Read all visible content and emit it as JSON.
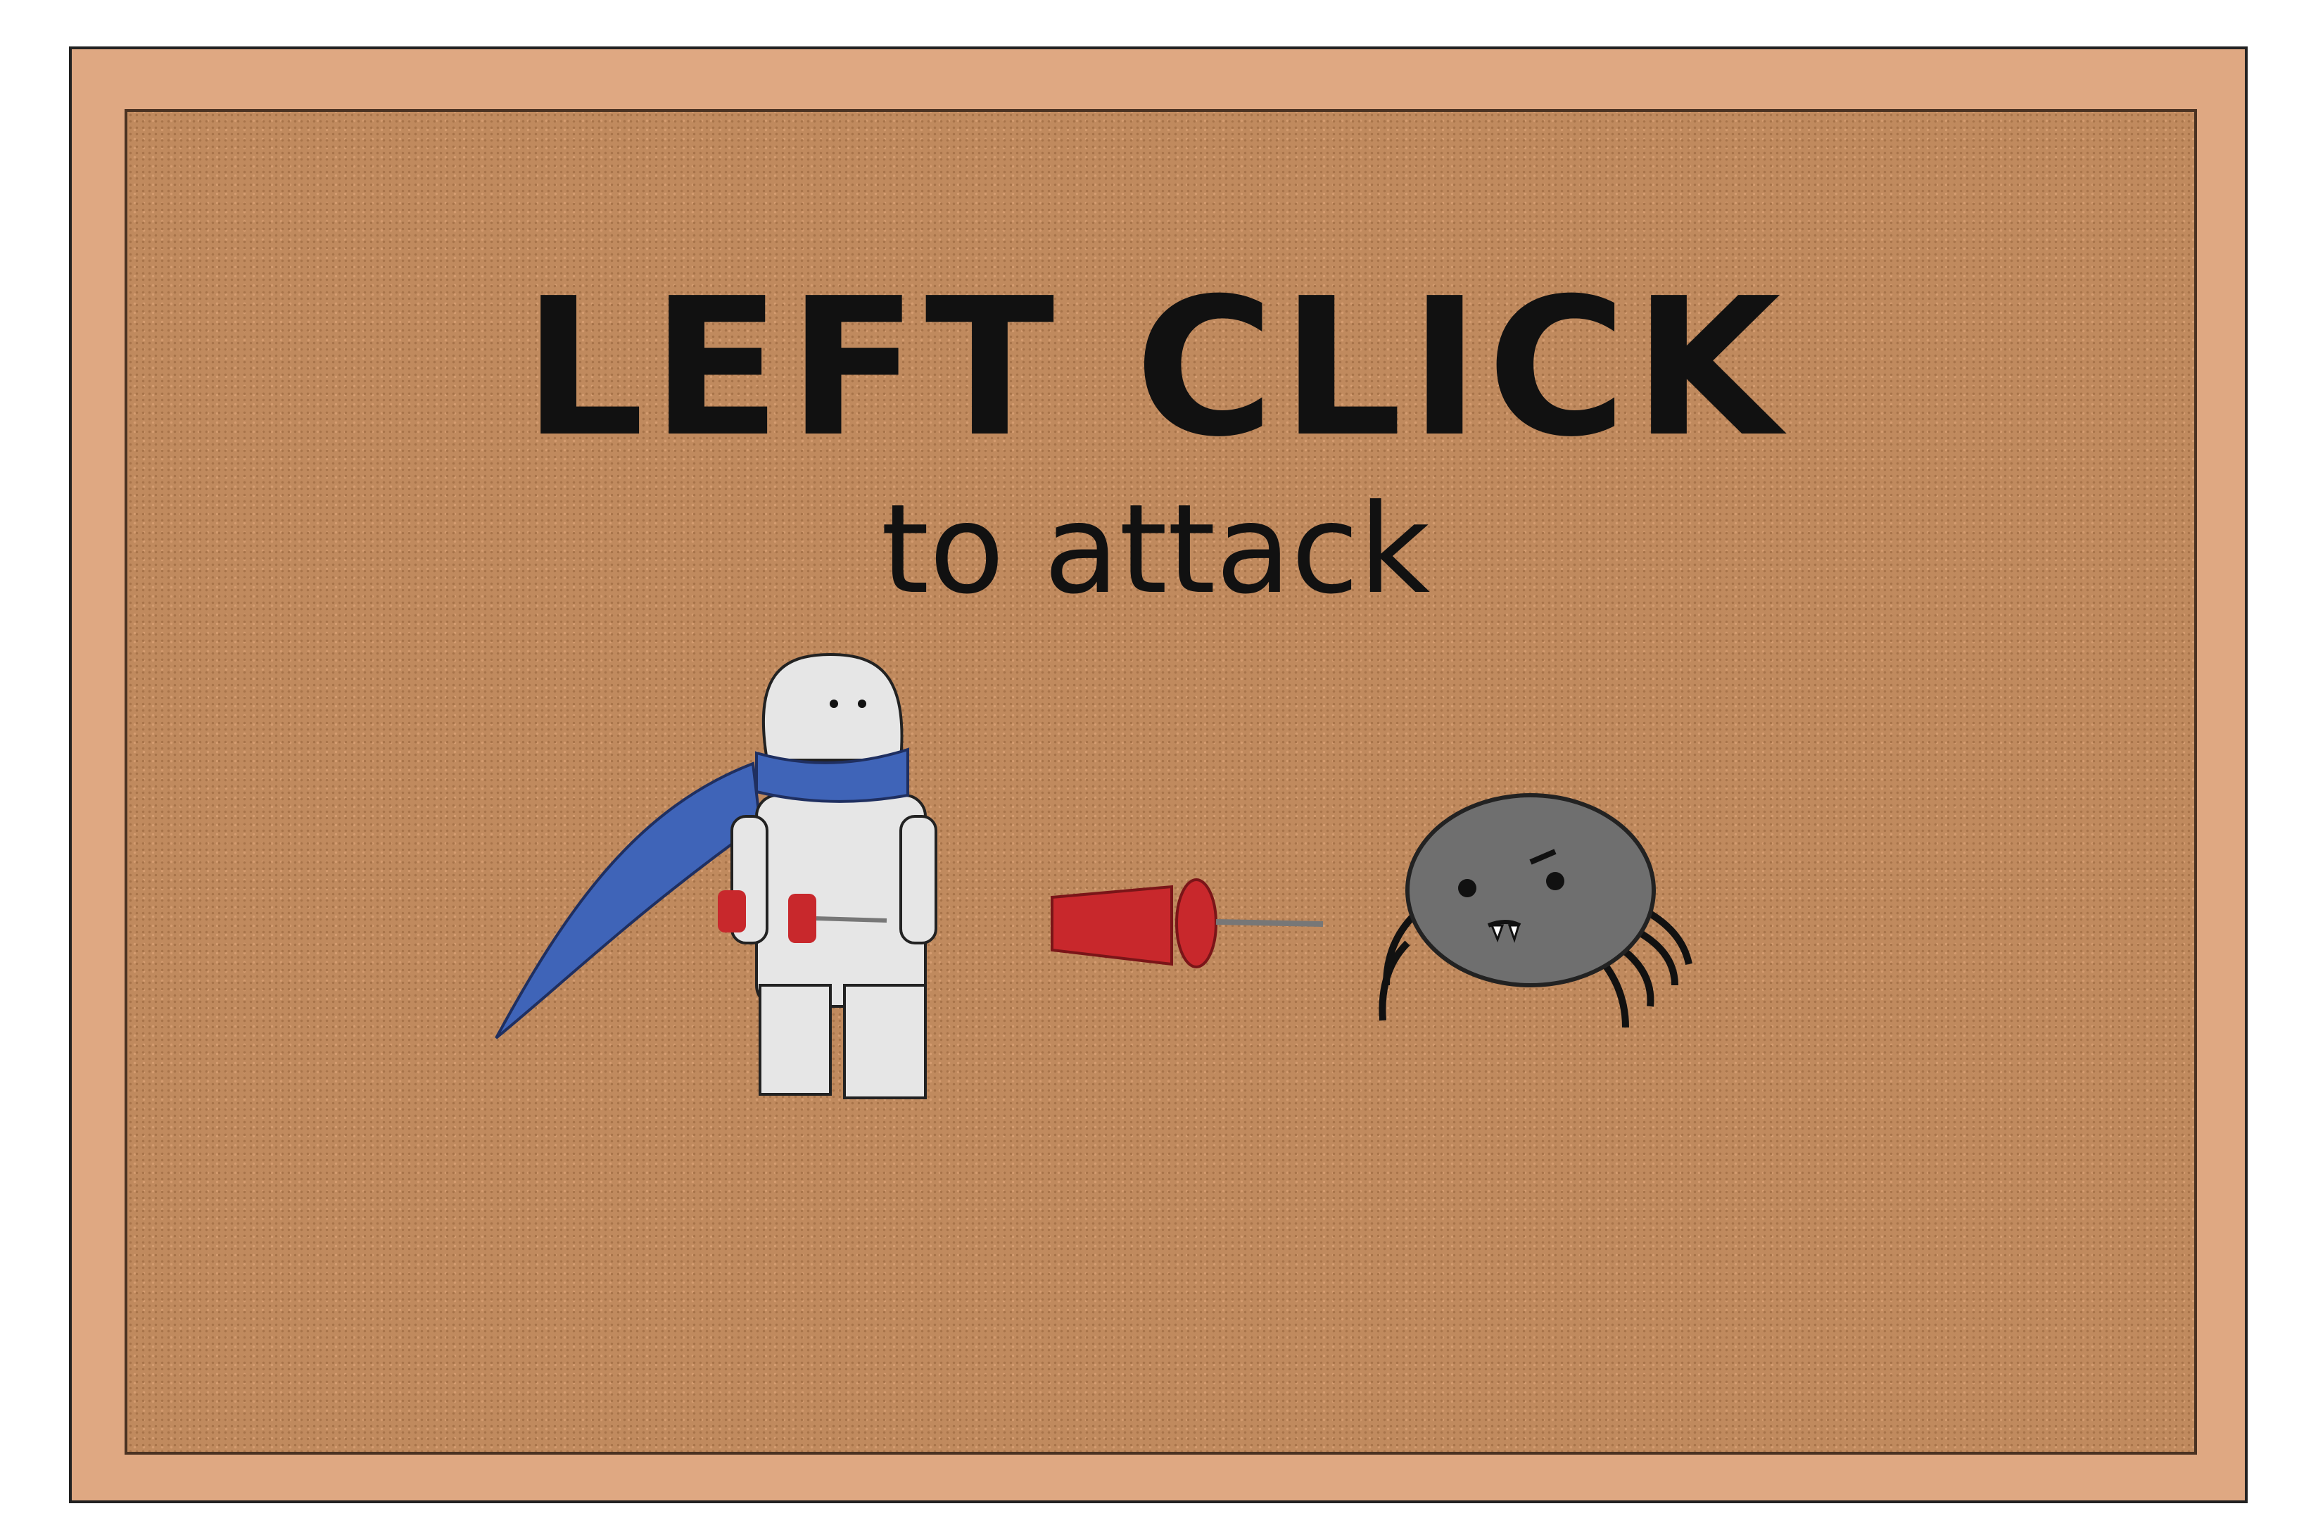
{
  "tutorial": {
    "headline": "LEFT CLICK",
    "subline": "to attack"
  },
  "colors": {
    "frame": "#dfa882",
    "cork": "#c08a5e",
    "scarf": "#3f64b8",
    "pin": "#c8282c",
    "spider": "#6f6f6f"
  },
  "icons": [
    "player-character-icon",
    "pushpin-projectile-icon",
    "spider-enemy-icon"
  ]
}
